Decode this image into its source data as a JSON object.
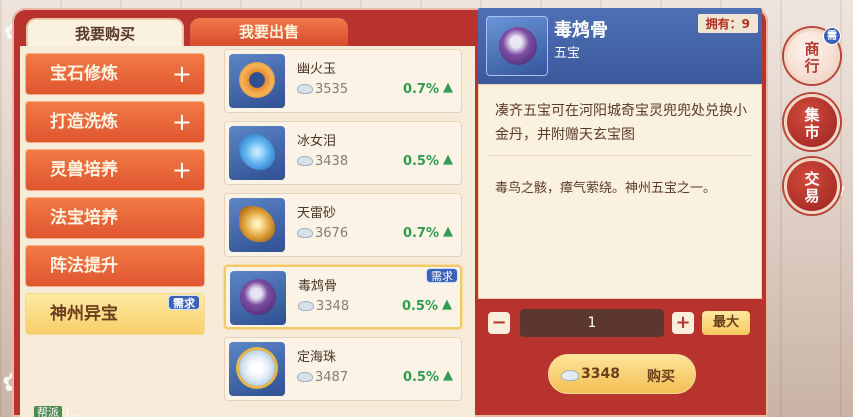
{
  "tabs": {
    "buy": "我要购买",
    "sell": "我要出售"
  },
  "categories": [
    {
      "label": "宝石修炼",
      "expand": "+"
    },
    {
      "label": "打造洗炼",
      "expand": "+"
    },
    {
      "label": "灵兽培养",
      "expand": "+"
    },
    {
      "label": "法宝培养",
      "expand": ""
    },
    {
      "label": "阵法提升",
      "expand": ""
    },
    {
      "label": "神州异宝",
      "expand": "",
      "badge": "需求"
    }
  ],
  "items": [
    {
      "name": "幽火玉",
      "price": "3535",
      "change": "0.7%",
      "trend": "up",
      "gem_color": "#e88a2c"
    },
    {
      "name": "冰女泪",
      "price": "3438",
      "change": "0.5%",
      "trend": "up",
      "gem_color": "#5fb4ef"
    },
    {
      "name": "天雷砂",
      "price": "3676",
      "change": "0.7%",
      "trend": "up",
      "gem_color": "#e0a23a"
    },
    {
      "name": "毒鸩骨",
      "price": "3348",
      "change": "0.5%",
      "trend": "up",
      "gem_color": "#7d4ea3",
      "badge": "需求"
    },
    {
      "name": "定海珠",
      "price": "3487",
      "change": "0.5%",
      "trend": "up",
      "gem_color": "#dce9f5"
    }
  ],
  "detail": {
    "title": "毒鸩骨",
    "subtitle": "五宝",
    "own": "拥有：9",
    "desc1": "凑齐五宝可在河阳城奇宝灵兜兜处兑换小金丹，并附赠天玄宝图",
    "desc2": "毒鸟之骸，瘴气萦绕。神州五宝之一。",
    "gem_color": "#7d4ea3"
  },
  "purchase": {
    "minus": "−",
    "quantity": "1",
    "plus": "+",
    "max_label": "最大",
    "price": "3348",
    "buy_label": "购买"
  },
  "nav": [
    {
      "label_top": "商",
      "label_bottom": "行",
      "badge": "需"
    },
    {
      "label_top": "集",
      "label_bottom": "市"
    },
    {
      "label_top": "交",
      "label_bottom": "易"
    }
  ],
  "chat": {
    "channel": "帮派",
    "text": "[..."
  },
  "trend_icon": "up-arrow-icon"
}
